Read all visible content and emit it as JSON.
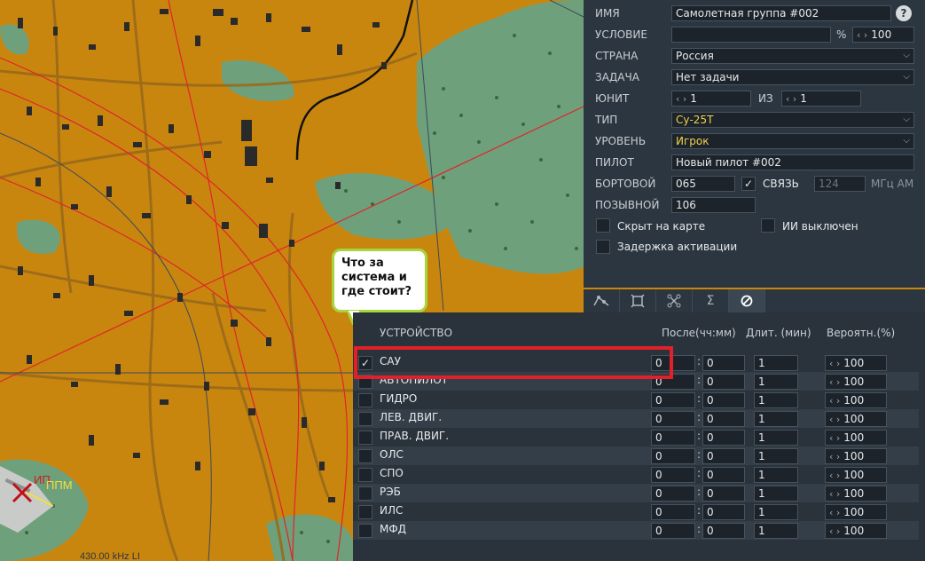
{
  "map": {
    "wp_label_red": "ИП",
    "wp_label_yellow": "ППМ",
    "freq_text": "430.00 kHz LI"
  },
  "callout": {
    "lines": [
      "Что за",
      "система и",
      "где стоит?"
    ]
  },
  "props": {
    "name_label": "ИМЯ",
    "name_value": "Самолетная группа #002",
    "help": "?",
    "condition_label": "УСЛОВИЕ",
    "condition_value": "",
    "percent": "%",
    "condition_prob": "100",
    "country_label": "СТРАНА",
    "country_value": "Россия",
    "task_label": "ЗАДАЧА",
    "task_value": "Нет задачи",
    "unit_label": "ЮНИТ",
    "unit_value": "1",
    "of_label": "ИЗ",
    "of_value": "1",
    "type_label": "ТИП",
    "type_value": "Су-25Т",
    "level_label": "УРОВЕНЬ",
    "level_value": "Игрок",
    "pilot_label": "ПИЛОТ",
    "pilot_value": "Новый пилот #002",
    "board_label": "БОРТОВОЙ",
    "board_value": "065",
    "radio_check": "✓",
    "radio_label": "СВЯЗЬ",
    "radio_freq": "124",
    "radio_unit": "МГц АМ",
    "callsign_label": "ПОЗЫВНОЙ",
    "callsign_value": "106",
    "hidden_label": "Скрыт на карте",
    "ai_off_label": "ИИ выключен",
    "delay_label": "Задержка активации"
  },
  "tabs": [
    "route-icon",
    "payload-icon",
    "properties-icon",
    "summary-icon",
    "failures-icon"
  ],
  "failures": {
    "col_device": "УСТРОЙСТВО",
    "col_after": "После(чч:мм)",
    "col_duration": "Длит. (мин)",
    "col_prob": "Вероятн.(%)",
    "rows": [
      {
        "name": "САУ",
        "checked": "✓",
        "hh": "0",
        "mm": "0",
        "dur": "1",
        "prob": "100"
      },
      {
        "name": "АВТОПИЛОТ",
        "checked": "",
        "hh": "0",
        "mm": "0",
        "dur": "1",
        "prob": "100"
      },
      {
        "name": "ГИДРО",
        "checked": "",
        "hh": "0",
        "mm": "0",
        "dur": "1",
        "prob": "100"
      },
      {
        "name": "ЛЕВ. ДВИГ.",
        "checked": "",
        "hh": "0",
        "mm": "0",
        "dur": "1",
        "prob": "100"
      },
      {
        "name": "ПРАВ. ДВИГ.",
        "checked": "",
        "hh": "0",
        "mm": "0",
        "dur": "1",
        "prob": "100"
      },
      {
        "name": "ОЛС",
        "checked": "",
        "hh": "0",
        "mm": "0",
        "dur": "1",
        "prob": "100"
      },
      {
        "name": "СПО",
        "checked": "",
        "hh": "0",
        "mm": "0",
        "dur": "1",
        "prob": "100"
      },
      {
        "name": "РЭБ",
        "checked": "",
        "hh": "0",
        "mm": "0",
        "dur": "1",
        "prob": "100"
      },
      {
        "name": "ИЛС",
        "checked": "",
        "hh": "0",
        "mm": "0",
        "dur": "1",
        "prob": "100"
      },
      {
        "name": "МФД",
        "checked": "",
        "hh": "0",
        "mm": "0",
        "dur": "1",
        "prob": "100"
      }
    ]
  },
  "colors": {
    "terrain": "#c9860f",
    "forest": "#6fa07c",
    "panel": "#2c3640",
    "highlight": "#e2202a",
    "callout_border": "#a6d63b"
  }
}
